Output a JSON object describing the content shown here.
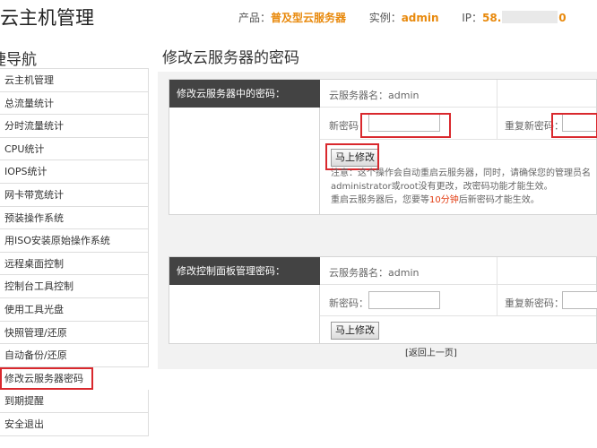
{
  "header": {
    "app_title": "云主机管理",
    "product_label": "产品：",
    "product_value": "普及型云服务器",
    "instance_label": "实例：",
    "instance_value": "admin",
    "ip_label": "IP：",
    "ip_value_start": "58.",
    "ip_value_end": "0"
  },
  "sidebar": {
    "title": "捷导航",
    "items": [
      {
        "label": "云主机管理"
      },
      {
        "label": "总流量统计"
      },
      {
        "label": "分时流量统计"
      },
      {
        "label": "CPU统计"
      },
      {
        "label": "IOPS统计"
      },
      {
        "label": "网卡带宽统计"
      },
      {
        "label": "预装操作系统"
      },
      {
        "label": "用ISO安装原始操作系统"
      },
      {
        "label": "远程桌面控制"
      },
      {
        "label": "控制台工具控制"
      },
      {
        "label": "使用工具光盘"
      },
      {
        "label": "快照管理/还原"
      },
      {
        "label": "自动备份/还原"
      },
      {
        "label": "修改云服务器密码"
      },
      {
        "label": "到期提醒"
      },
      {
        "label": "安全退出"
      }
    ]
  },
  "main": {
    "title": "修改云服务器的密码",
    "server_form": {
      "header_label": "修改云服务器中的密码：",
      "server_name": "云服务器名：admin",
      "new_password_label": "新密码",
      "new_password_value": "",
      "repeat_password_label": "重复新密码：",
      "repeat_password_value": "",
      "submit_label": "马上修改",
      "note_line1": "注意：这个操作会自动重启云服务器，同时，请确保您的管理员名",
      "note_line2": "administrator或root没有更改，改密码功能才能生效。",
      "note_line3a": "重启云服务器后，您要等",
      "note_line3b": "10分钟",
      "note_line3c": "后新密码才能生效。"
    },
    "panel_form": {
      "header_label": "修改控制面板管理密码：",
      "server_name": "云服务器名：admin",
      "new_password_label": "新密码：",
      "new_password_value": "",
      "repeat_password_label": "重复新密码：",
      "repeat_password_value": "",
      "submit_label": "马上修改"
    },
    "back_link": "[返回上一页]"
  },
  "colors": {
    "accent": "#e8890c",
    "highlight_red": "#d9282d",
    "header_cell_bg": "#434343"
  }
}
